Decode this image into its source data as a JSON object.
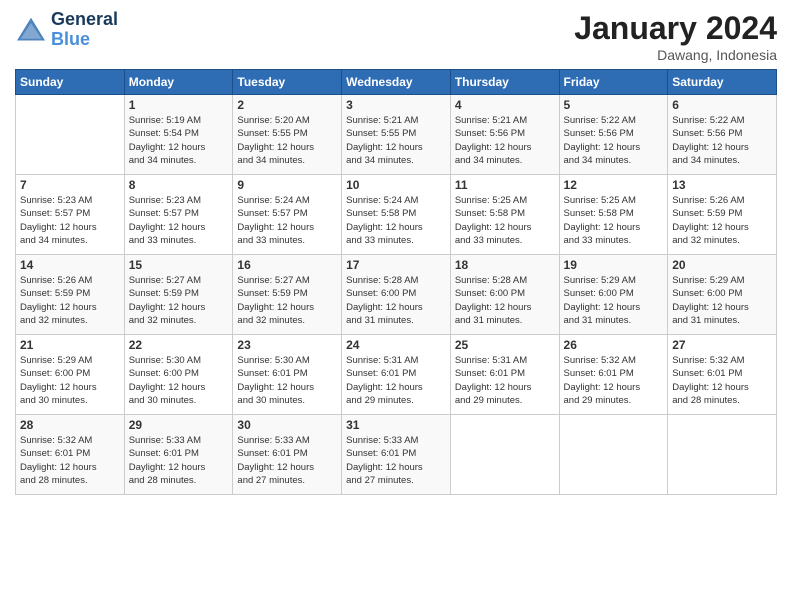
{
  "logo": {
    "line1": "General",
    "line2": "Blue"
  },
  "title": "January 2024",
  "location": "Dawang, Indonesia",
  "days_header": [
    "Sunday",
    "Monday",
    "Tuesday",
    "Wednesday",
    "Thursday",
    "Friday",
    "Saturday"
  ],
  "weeks": [
    [
      {
        "num": "",
        "info": ""
      },
      {
        "num": "1",
        "info": "Sunrise: 5:19 AM\nSunset: 5:54 PM\nDaylight: 12 hours\nand 34 minutes."
      },
      {
        "num": "2",
        "info": "Sunrise: 5:20 AM\nSunset: 5:55 PM\nDaylight: 12 hours\nand 34 minutes."
      },
      {
        "num": "3",
        "info": "Sunrise: 5:21 AM\nSunset: 5:55 PM\nDaylight: 12 hours\nand 34 minutes."
      },
      {
        "num": "4",
        "info": "Sunrise: 5:21 AM\nSunset: 5:56 PM\nDaylight: 12 hours\nand 34 minutes."
      },
      {
        "num": "5",
        "info": "Sunrise: 5:22 AM\nSunset: 5:56 PM\nDaylight: 12 hours\nand 34 minutes."
      },
      {
        "num": "6",
        "info": "Sunrise: 5:22 AM\nSunset: 5:56 PM\nDaylight: 12 hours\nand 34 minutes."
      }
    ],
    [
      {
        "num": "7",
        "info": "Sunrise: 5:23 AM\nSunset: 5:57 PM\nDaylight: 12 hours\nand 34 minutes."
      },
      {
        "num": "8",
        "info": "Sunrise: 5:23 AM\nSunset: 5:57 PM\nDaylight: 12 hours\nand 33 minutes."
      },
      {
        "num": "9",
        "info": "Sunrise: 5:24 AM\nSunset: 5:57 PM\nDaylight: 12 hours\nand 33 minutes."
      },
      {
        "num": "10",
        "info": "Sunrise: 5:24 AM\nSunset: 5:58 PM\nDaylight: 12 hours\nand 33 minutes."
      },
      {
        "num": "11",
        "info": "Sunrise: 5:25 AM\nSunset: 5:58 PM\nDaylight: 12 hours\nand 33 minutes."
      },
      {
        "num": "12",
        "info": "Sunrise: 5:25 AM\nSunset: 5:58 PM\nDaylight: 12 hours\nand 33 minutes."
      },
      {
        "num": "13",
        "info": "Sunrise: 5:26 AM\nSunset: 5:59 PM\nDaylight: 12 hours\nand 32 minutes."
      }
    ],
    [
      {
        "num": "14",
        "info": "Sunrise: 5:26 AM\nSunset: 5:59 PM\nDaylight: 12 hours\nand 32 minutes."
      },
      {
        "num": "15",
        "info": "Sunrise: 5:27 AM\nSunset: 5:59 PM\nDaylight: 12 hours\nand 32 minutes."
      },
      {
        "num": "16",
        "info": "Sunrise: 5:27 AM\nSunset: 5:59 PM\nDaylight: 12 hours\nand 32 minutes."
      },
      {
        "num": "17",
        "info": "Sunrise: 5:28 AM\nSunset: 6:00 PM\nDaylight: 12 hours\nand 31 minutes."
      },
      {
        "num": "18",
        "info": "Sunrise: 5:28 AM\nSunset: 6:00 PM\nDaylight: 12 hours\nand 31 minutes."
      },
      {
        "num": "19",
        "info": "Sunrise: 5:29 AM\nSunset: 6:00 PM\nDaylight: 12 hours\nand 31 minutes."
      },
      {
        "num": "20",
        "info": "Sunrise: 5:29 AM\nSunset: 6:00 PM\nDaylight: 12 hours\nand 31 minutes."
      }
    ],
    [
      {
        "num": "21",
        "info": "Sunrise: 5:29 AM\nSunset: 6:00 PM\nDaylight: 12 hours\nand 30 minutes."
      },
      {
        "num": "22",
        "info": "Sunrise: 5:30 AM\nSunset: 6:00 PM\nDaylight: 12 hours\nand 30 minutes."
      },
      {
        "num": "23",
        "info": "Sunrise: 5:30 AM\nSunset: 6:01 PM\nDaylight: 12 hours\nand 30 minutes."
      },
      {
        "num": "24",
        "info": "Sunrise: 5:31 AM\nSunset: 6:01 PM\nDaylight: 12 hours\nand 29 minutes."
      },
      {
        "num": "25",
        "info": "Sunrise: 5:31 AM\nSunset: 6:01 PM\nDaylight: 12 hours\nand 29 minutes."
      },
      {
        "num": "26",
        "info": "Sunrise: 5:32 AM\nSunset: 6:01 PM\nDaylight: 12 hours\nand 29 minutes."
      },
      {
        "num": "27",
        "info": "Sunrise: 5:32 AM\nSunset: 6:01 PM\nDaylight: 12 hours\nand 28 minutes."
      }
    ],
    [
      {
        "num": "28",
        "info": "Sunrise: 5:32 AM\nSunset: 6:01 PM\nDaylight: 12 hours\nand 28 minutes."
      },
      {
        "num": "29",
        "info": "Sunrise: 5:33 AM\nSunset: 6:01 PM\nDaylight: 12 hours\nand 28 minutes."
      },
      {
        "num": "30",
        "info": "Sunrise: 5:33 AM\nSunset: 6:01 PM\nDaylight: 12 hours\nand 27 minutes."
      },
      {
        "num": "31",
        "info": "Sunrise: 5:33 AM\nSunset: 6:01 PM\nDaylight: 12 hours\nand 27 minutes."
      },
      {
        "num": "",
        "info": ""
      },
      {
        "num": "",
        "info": ""
      },
      {
        "num": "",
        "info": ""
      }
    ]
  ]
}
